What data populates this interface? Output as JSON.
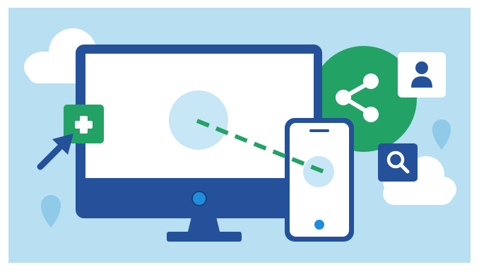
{
  "scene": {
    "kind": "illustration",
    "icons": [
      "cloud-icon",
      "desktop-monitor-icon",
      "smartphone-icon",
      "add-plus-icon",
      "mouse-cursor-icon",
      "share-network-icon",
      "user-profile-icon",
      "search-magnifier-icon",
      "location-pin-icon"
    ],
    "colors": {
      "background": "#b8dff2",
      "frame": "#ffffff",
      "navy": "#24519a",
      "navy_dark": "#1f468a",
      "screen": "#ffffff",
      "green": "#23a265",
      "light_blue": "#c7e6f6",
      "pin_blue": "#8fcae9",
      "dot_blue": "#1e8ddc",
      "cloud": "#ffffff"
    }
  }
}
